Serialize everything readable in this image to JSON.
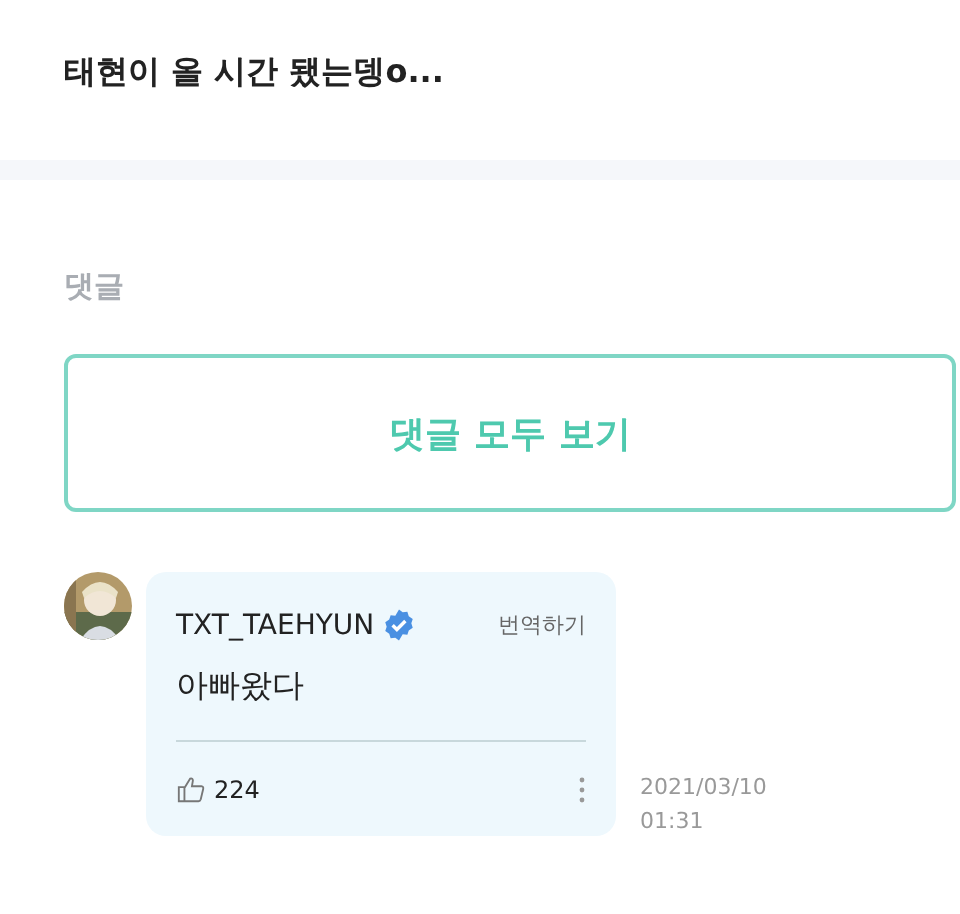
{
  "post": {
    "title": "태현이 올 시간 됐는뎅o..."
  },
  "comments_section": {
    "heading": "댓글",
    "view_all_button": "댓글 모두 보기"
  },
  "comments": [
    {
      "author": "TXT_TAEHYUN",
      "verified": true,
      "translate": "번역하기",
      "text": "아빠왔다",
      "likes": "224",
      "date": "2021/03/10",
      "time": "01:31"
    }
  ]
}
